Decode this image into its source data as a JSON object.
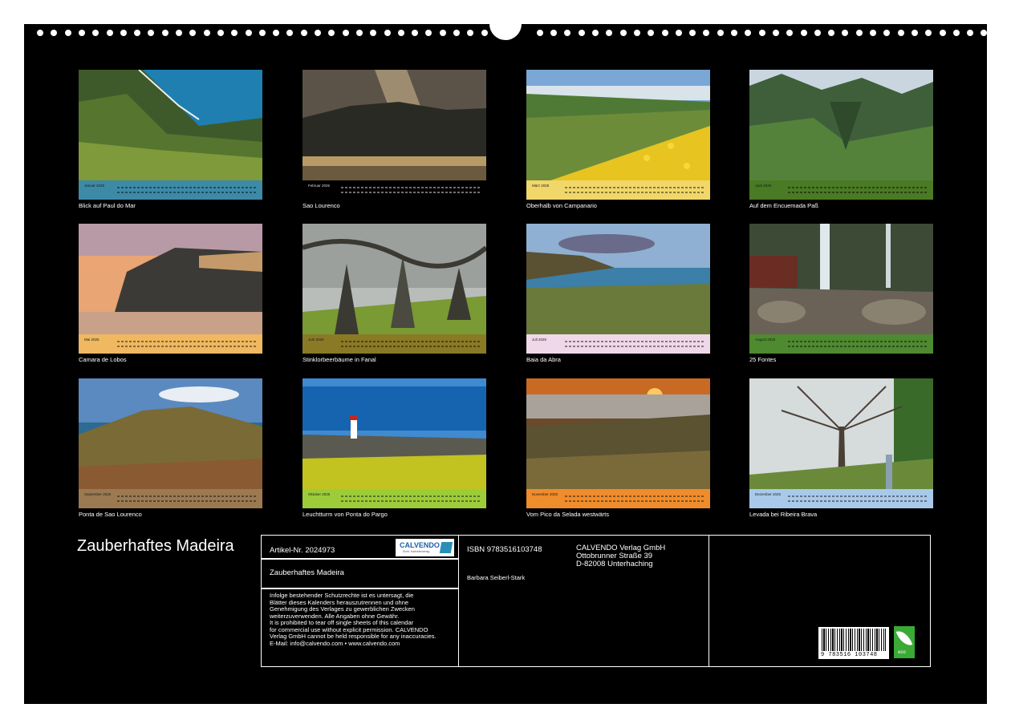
{
  "title": "Zauberhaftes Madeira",
  "months": [
    {
      "label": "Januar 2025",
      "caption": "Blick auf Paul do Mar",
      "color": "#3d8aa6",
      "scene": "coast"
    },
    {
      "label": "Februar 2025",
      "caption": "Sao Lourenco",
      "color": "#000000",
      "scene": "sunrays"
    },
    {
      "label": "März 2025",
      "caption": "Oberhalb von Campanario",
      "color": "#f1d76a",
      "scene": "flowers"
    },
    {
      "label": "April 2025",
      "caption": "Auf dem Encuemada Paß",
      "color": "#4a7a24",
      "scene": "valley"
    },
    {
      "label": "Mai 2025",
      "caption": "Camara de Lobos",
      "color": "#f0b860",
      "scene": "sunset"
    },
    {
      "label": "Juni 2025",
      "caption": "Stinklorbeerbäume in Fanal",
      "color": "#8a7a26",
      "scene": "fog"
    },
    {
      "label": "Juli 2025",
      "caption": "Baia da Abra",
      "color": "#efd8ea",
      "scene": "bay"
    },
    {
      "label": "August 2025",
      "caption": "25 Fontes",
      "color": "#4e8a30",
      "scene": "waterfall"
    },
    {
      "label": "September 2025",
      "caption": "Ponta de Sao Lourenco",
      "color": "#9b7a52",
      "scene": "cliffs"
    },
    {
      "label": "Oktober 2025",
      "caption": "Leuchtturm von Ponta do Pargo",
      "color": "#9ccc3a",
      "scene": "lighthouse"
    },
    {
      "label": "November 2025",
      "caption": "Vom Pico da Selada westwärts",
      "color": "#ef8c2c",
      "scene": "clouds"
    },
    {
      "label": "Dezember 2025",
      "caption": "Levada bei Ribeira Brava",
      "color": "#a9c9ea",
      "scene": "tree"
    }
  ],
  "info": {
    "article": "Artikel-Nr. 2024973",
    "logo_text": "CALVENDO",
    "logo_sub": "Sicht. Kalenderverlag",
    "title": "Zauberhaftes Madeira",
    "notice": [
      "Infolge bestehender Schutzrechte ist es untersagt, die",
      "Blätter dieses Kalenders herauszutrennen und ohne",
      "Genehmigung des Verlages zu gewerblichen Zwecken",
      "weiterzuverwenden. Alle Angaben ohne Gewähr.",
      "It is prohibited to tear off single sheets of this calendar",
      "for commercial use without explicit permission. CALVENDO",
      "Verlag GmbH cannot be held responsible for any inaccuracies.",
      "E-Mail: info@calvendo.com • www.calvendo.com"
    ],
    "isbn": "ISBN 9783516103748",
    "author": "Barbara Seiberl-Stark",
    "publisher": [
      "CALVENDO Verlag GmbH",
      "Ottobrunner Straße 39",
      "D-82008 Unterhaching"
    ],
    "barcode_number": "9 783516 103748",
    "eco_label": "eco"
  }
}
